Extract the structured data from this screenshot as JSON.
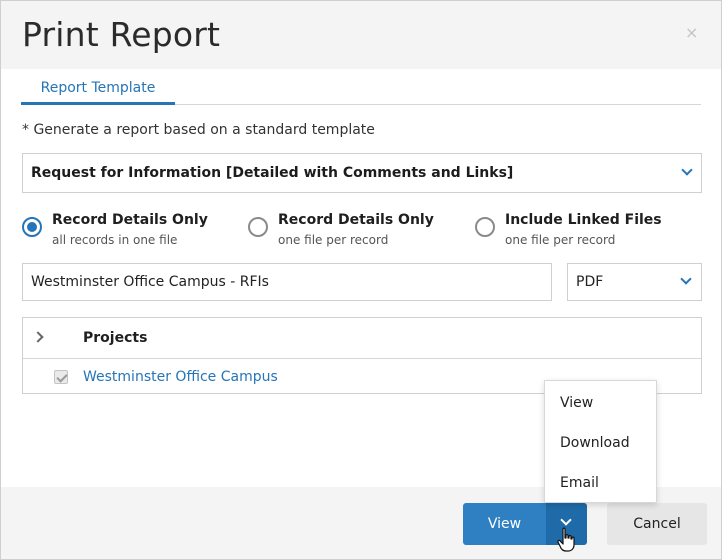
{
  "dialog": {
    "title": "Print Report",
    "close_glyph": "×"
  },
  "tabs": [
    {
      "label": "Report Template",
      "active": true
    }
  ],
  "hint": "* Generate a report based on a standard template",
  "template_select": {
    "value": "Request for Information [Detailed with Comments and Links]"
  },
  "radio_options": [
    {
      "title": "Record Details Only",
      "subtitle": "all records in one file",
      "selected": true
    },
    {
      "title": "Record Details Only",
      "subtitle": "one file per record",
      "selected": false
    },
    {
      "title": "Include Linked Files",
      "subtitle": "one file per record",
      "selected": false
    }
  ],
  "report_name": {
    "value": "Westminster Office Campus - RFIs"
  },
  "format_select": {
    "value": "PDF"
  },
  "projects": {
    "header": "Projects",
    "rows": [
      {
        "name": "Westminster Office Campus",
        "checked": true
      }
    ]
  },
  "dropdown_menu": {
    "items": [
      "View",
      "Download",
      "Email"
    ]
  },
  "footer": {
    "view_label": "View",
    "cancel_label": "Cancel"
  },
  "colors": {
    "accent": "#2575b7",
    "primary_button": "#2f80c2",
    "primary_button_dark": "#1f6aa8",
    "header_bg": "#f4f4f4"
  },
  "icons": {
    "close": "close-icon",
    "dropdown": "chevron-down-icon",
    "expander": "chevron-right-icon",
    "cursor": "hand-pointer-icon"
  }
}
